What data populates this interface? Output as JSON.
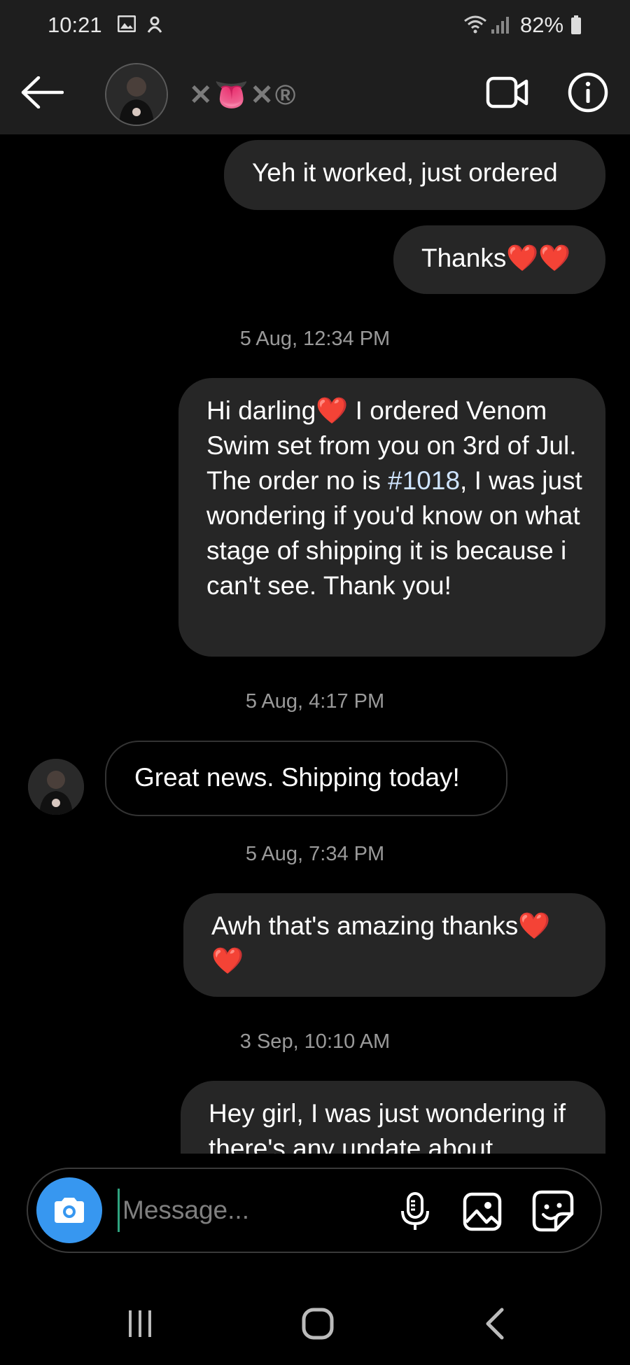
{
  "status_bar": {
    "time": "10:21",
    "battery": "82%"
  },
  "header": {
    "username": "✕👅✕®",
    "back_icon": "arrow-left-icon",
    "video_icon": "video-camera-icon",
    "info_icon": "info-icon"
  },
  "messages": [
    {
      "type": "sent",
      "text": "Yeh it worked, just ordered"
    },
    {
      "type": "sent",
      "text": "Thanks❤️❤️"
    },
    {
      "type": "timestamp",
      "text": "5 Aug, 12:34 PM"
    },
    {
      "type": "sent",
      "text_before": "Hi darling❤️ I ordered Venom Swim set from you on 3rd of Jul. The order no is ",
      "link": "#1018",
      "text_after": ", I was just wondering if you'd know on what stage of shipping it is because i can't see. Thank you!"
    },
    {
      "type": "timestamp",
      "text": "5 Aug, 4:17 PM"
    },
    {
      "type": "received",
      "text": "Great news. Shipping today!"
    },
    {
      "type": "timestamp",
      "text": "5 Aug, 7:34 PM"
    },
    {
      "type": "sent",
      "text": "Awh that's amazing thanks❤️ ❤️"
    },
    {
      "type": "timestamp",
      "text": "3 Sep, 10:10 AM"
    },
    {
      "type": "sent",
      "text": "Hey girl, I was just wondering if there's any update about"
    }
  ],
  "composer": {
    "placeholder": "Message..."
  },
  "colors": {
    "accent": "#3797f0",
    "bubble_sent": "#262626",
    "background": "#000000"
  }
}
